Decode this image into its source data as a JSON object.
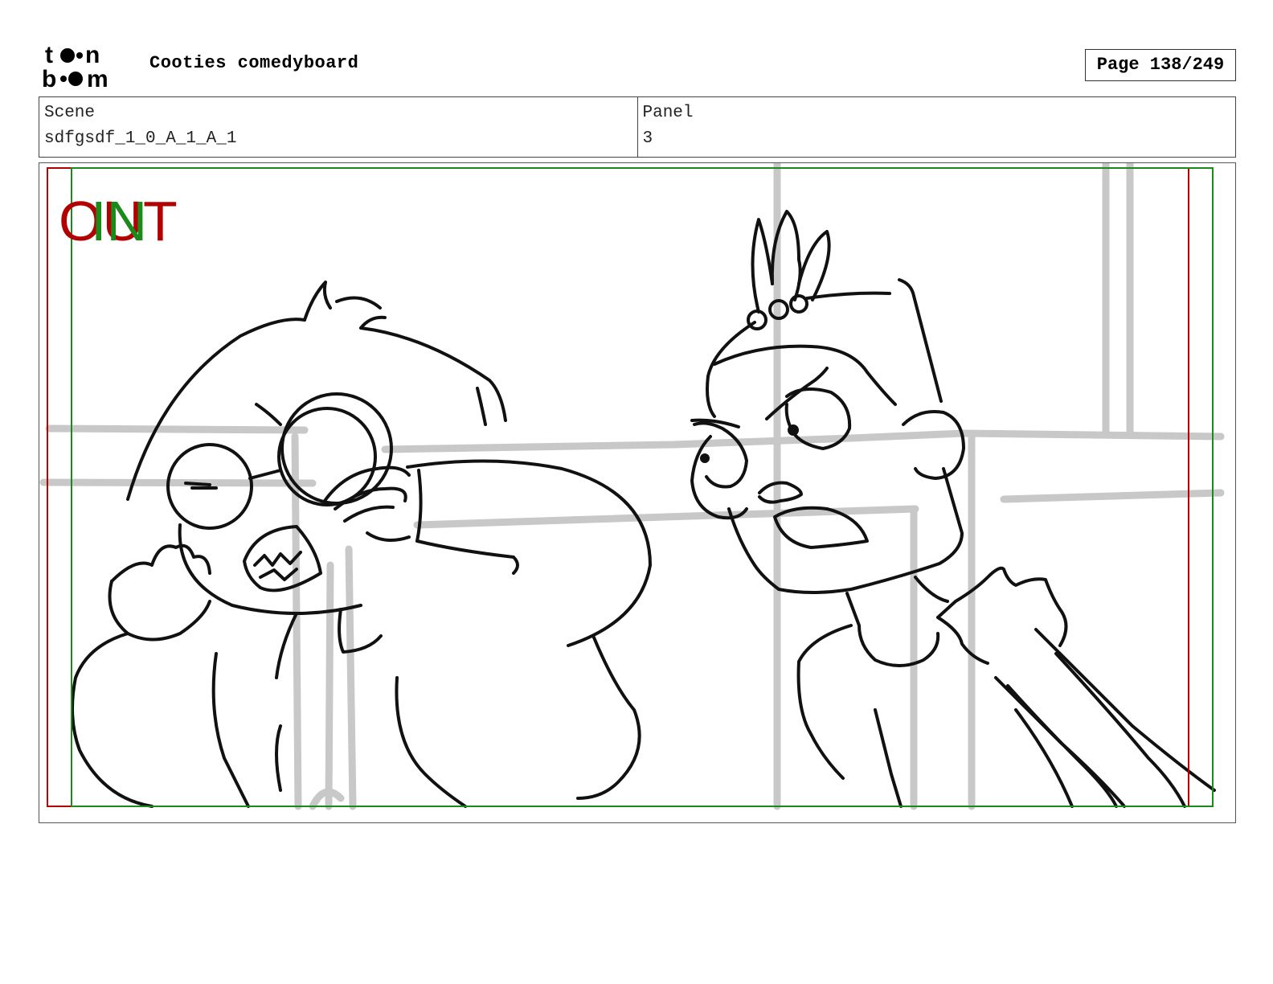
{
  "header": {
    "logo_text_top": "toon",
    "logo_text_bottom": "boom",
    "title": "Cooties comedyboard",
    "page_label": "Page 138/249"
  },
  "info": {
    "scene_label": "Scene",
    "scene_value": "sdfgsdf_1_0_A_1_A_1",
    "panel_label": "Panel",
    "panel_value": "3"
  },
  "panel": {
    "out_label": "OUT",
    "in_label": "IN",
    "colors": {
      "out": "#b30000",
      "in": "#1a8a1a",
      "sketch": "#111111",
      "background_lines": "#c8c8c8"
    }
  }
}
